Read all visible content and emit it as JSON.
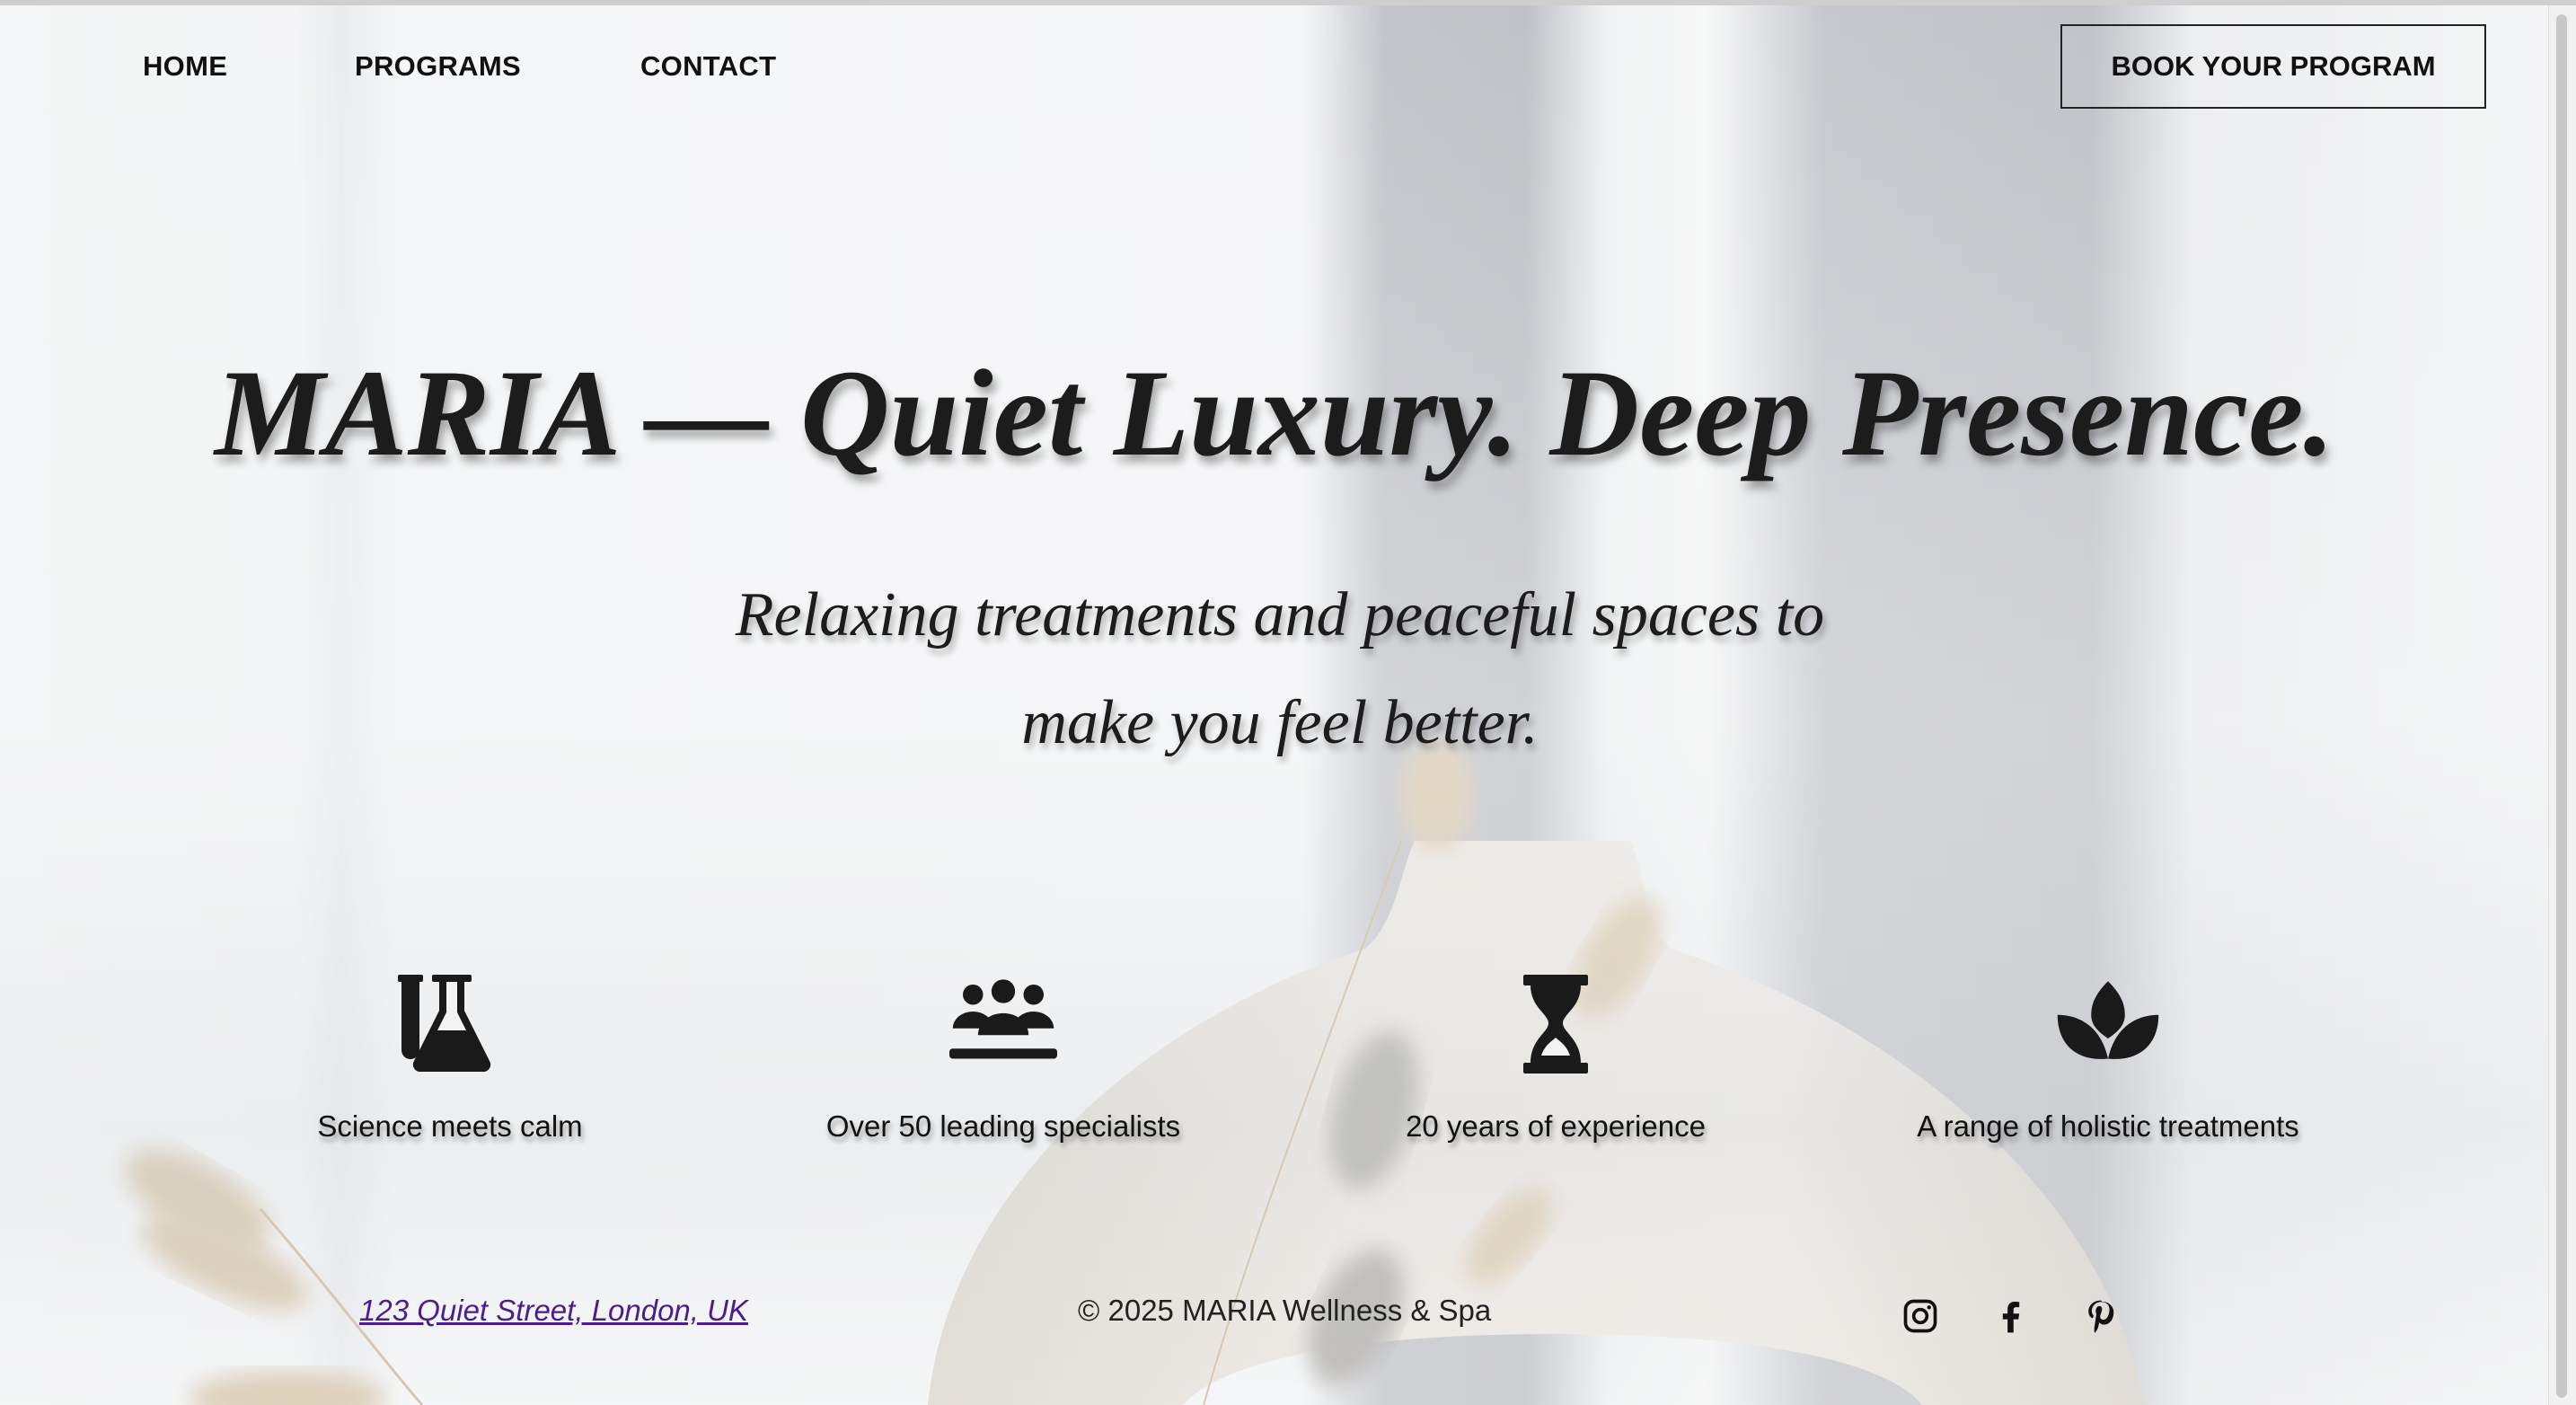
{
  "nav": {
    "items": [
      {
        "label": "HOME"
      },
      {
        "label": "PROGRAMS"
      },
      {
        "label": "CONTACT"
      }
    ],
    "cta_label": "BOOK YOUR PROGRAM"
  },
  "hero": {
    "title": "MARIA — Quiet Luxury. Deep Presence.",
    "subtitle_line1": "Relaxing treatments and peaceful spaces to",
    "subtitle_line2": "make you feel better."
  },
  "features": [
    {
      "icon": "flask-icon",
      "label": "Science meets calm"
    },
    {
      "icon": "users-icon",
      "label": "Over 50 leading specialists"
    },
    {
      "icon": "hourglass-icon",
      "label": "20 years of experience"
    },
    {
      "icon": "lotus-icon",
      "label": "A range of holistic treatments"
    }
  ],
  "footer": {
    "address": "123 Quiet Street, London, UK",
    "copyright": "© 2025 MARIA Wellness & Spa",
    "social": [
      "instagram-icon",
      "facebook-icon",
      "pinterest-icon"
    ]
  },
  "colors": {
    "link": "#4b1d8f",
    "text": "#1a1a1a",
    "vase": "#e6ddd0"
  }
}
